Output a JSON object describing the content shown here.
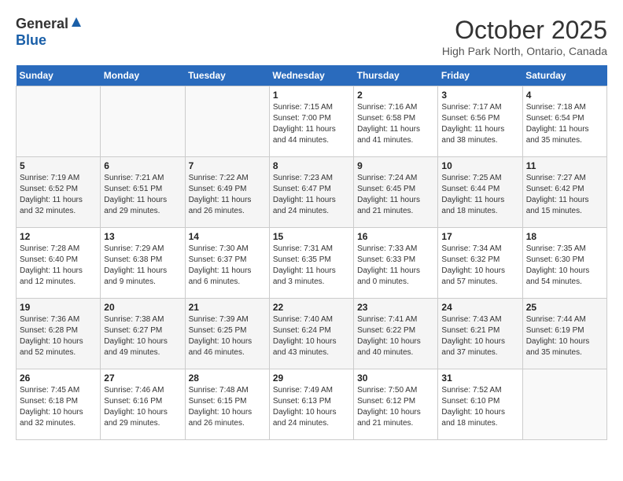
{
  "header": {
    "logo_general": "General",
    "logo_blue": "Blue",
    "month": "October 2025",
    "location": "High Park North, Ontario, Canada"
  },
  "days_of_week": [
    "Sunday",
    "Monday",
    "Tuesday",
    "Wednesday",
    "Thursday",
    "Friday",
    "Saturday"
  ],
  "weeks": [
    [
      {
        "day": "",
        "info": ""
      },
      {
        "day": "",
        "info": ""
      },
      {
        "day": "",
        "info": ""
      },
      {
        "day": "1",
        "info": "Sunrise: 7:15 AM\nSunset: 7:00 PM\nDaylight: 11 hours and 44 minutes."
      },
      {
        "day": "2",
        "info": "Sunrise: 7:16 AM\nSunset: 6:58 PM\nDaylight: 11 hours and 41 minutes."
      },
      {
        "day": "3",
        "info": "Sunrise: 7:17 AM\nSunset: 6:56 PM\nDaylight: 11 hours and 38 minutes."
      },
      {
        "day": "4",
        "info": "Sunrise: 7:18 AM\nSunset: 6:54 PM\nDaylight: 11 hours and 35 minutes."
      }
    ],
    [
      {
        "day": "5",
        "info": "Sunrise: 7:19 AM\nSunset: 6:52 PM\nDaylight: 11 hours and 32 minutes."
      },
      {
        "day": "6",
        "info": "Sunrise: 7:21 AM\nSunset: 6:51 PM\nDaylight: 11 hours and 29 minutes."
      },
      {
        "day": "7",
        "info": "Sunrise: 7:22 AM\nSunset: 6:49 PM\nDaylight: 11 hours and 26 minutes."
      },
      {
        "day": "8",
        "info": "Sunrise: 7:23 AM\nSunset: 6:47 PM\nDaylight: 11 hours and 24 minutes."
      },
      {
        "day": "9",
        "info": "Sunrise: 7:24 AM\nSunset: 6:45 PM\nDaylight: 11 hours and 21 minutes."
      },
      {
        "day": "10",
        "info": "Sunrise: 7:25 AM\nSunset: 6:44 PM\nDaylight: 11 hours and 18 minutes."
      },
      {
        "day": "11",
        "info": "Sunrise: 7:27 AM\nSunset: 6:42 PM\nDaylight: 11 hours and 15 minutes."
      }
    ],
    [
      {
        "day": "12",
        "info": "Sunrise: 7:28 AM\nSunset: 6:40 PM\nDaylight: 11 hours and 12 minutes."
      },
      {
        "day": "13",
        "info": "Sunrise: 7:29 AM\nSunset: 6:38 PM\nDaylight: 11 hours and 9 minutes."
      },
      {
        "day": "14",
        "info": "Sunrise: 7:30 AM\nSunset: 6:37 PM\nDaylight: 11 hours and 6 minutes."
      },
      {
        "day": "15",
        "info": "Sunrise: 7:31 AM\nSunset: 6:35 PM\nDaylight: 11 hours and 3 minutes."
      },
      {
        "day": "16",
        "info": "Sunrise: 7:33 AM\nSunset: 6:33 PM\nDaylight: 11 hours and 0 minutes."
      },
      {
        "day": "17",
        "info": "Sunrise: 7:34 AM\nSunset: 6:32 PM\nDaylight: 10 hours and 57 minutes."
      },
      {
        "day": "18",
        "info": "Sunrise: 7:35 AM\nSunset: 6:30 PM\nDaylight: 10 hours and 54 minutes."
      }
    ],
    [
      {
        "day": "19",
        "info": "Sunrise: 7:36 AM\nSunset: 6:28 PM\nDaylight: 10 hours and 52 minutes."
      },
      {
        "day": "20",
        "info": "Sunrise: 7:38 AM\nSunset: 6:27 PM\nDaylight: 10 hours and 49 minutes."
      },
      {
        "day": "21",
        "info": "Sunrise: 7:39 AM\nSunset: 6:25 PM\nDaylight: 10 hours and 46 minutes."
      },
      {
        "day": "22",
        "info": "Sunrise: 7:40 AM\nSunset: 6:24 PM\nDaylight: 10 hours and 43 minutes."
      },
      {
        "day": "23",
        "info": "Sunrise: 7:41 AM\nSunset: 6:22 PM\nDaylight: 10 hours and 40 minutes."
      },
      {
        "day": "24",
        "info": "Sunrise: 7:43 AM\nSunset: 6:21 PM\nDaylight: 10 hours and 37 minutes."
      },
      {
        "day": "25",
        "info": "Sunrise: 7:44 AM\nSunset: 6:19 PM\nDaylight: 10 hours and 35 minutes."
      }
    ],
    [
      {
        "day": "26",
        "info": "Sunrise: 7:45 AM\nSunset: 6:18 PM\nDaylight: 10 hours and 32 minutes."
      },
      {
        "day": "27",
        "info": "Sunrise: 7:46 AM\nSunset: 6:16 PM\nDaylight: 10 hours and 29 minutes."
      },
      {
        "day": "28",
        "info": "Sunrise: 7:48 AM\nSunset: 6:15 PM\nDaylight: 10 hours and 26 minutes."
      },
      {
        "day": "29",
        "info": "Sunrise: 7:49 AM\nSunset: 6:13 PM\nDaylight: 10 hours and 24 minutes."
      },
      {
        "day": "30",
        "info": "Sunrise: 7:50 AM\nSunset: 6:12 PM\nDaylight: 10 hours and 21 minutes."
      },
      {
        "day": "31",
        "info": "Sunrise: 7:52 AM\nSunset: 6:10 PM\nDaylight: 10 hours and 18 minutes."
      },
      {
        "day": "",
        "info": ""
      }
    ]
  ]
}
